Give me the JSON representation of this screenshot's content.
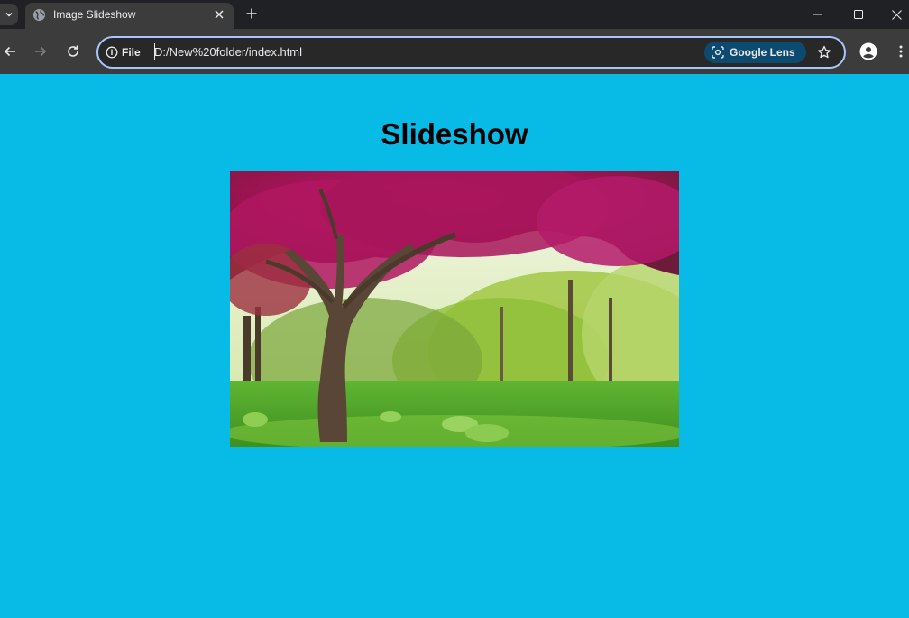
{
  "browser": {
    "tab": {
      "title": "Image Slideshow"
    },
    "omnibox": {
      "site_info_label": "File",
      "url": "D:/New%20folder/index.html",
      "lens_label": "Google Lens"
    }
  },
  "page": {
    "title": "Slideshow",
    "slide": {
      "description_icon": "tree-photo"
    }
  },
  "colors": {
    "page_background": "#07bbe6",
    "chrome_dark": "#202124",
    "toolbar": "#3c3c3c",
    "omnibox_border": "#a8c7fa",
    "lens_chip": "#0d4a6f"
  }
}
